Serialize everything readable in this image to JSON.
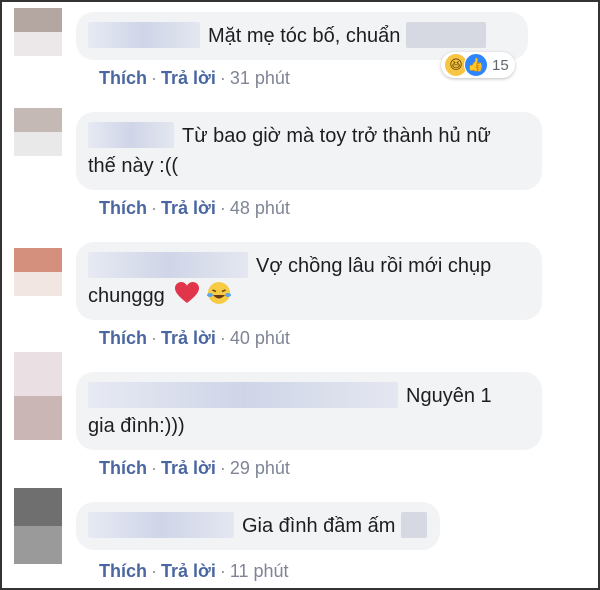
{
  "comments": [
    {
      "text": "Mặt mẹ tóc bố, chuẩn",
      "like": "Thích",
      "reply": "Trả lời",
      "time": "31 phút",
      "reactions": {
        "types": [
          "haha-icon",
          "like-icon"
        ],
        "count": "15"
      },
      "avatar_colors": [
        "#b4a7a1",
        "#ece8e9"
      ]
    },
    {
      "text_line1": "Từ bao giờ mà toy trở thành hủ nữ",
      "text_line2": "thế này :((",
      "like": "Thích",
      "reply": "Trả lời",
      "time": "48 phút",
      "avatar_colors": [
        "#c4b9b4",
        "#e9e9e9"
      ]
    },
    {
      "text_line1": "Vợ chồng lâu rồi mới chụp",
      "text_line2": "chunggg",
      "emojis": [
        "heart-icon",
        "tears-of-joy-icon"
      ],
      "like": "Thích",
      "reply": "Trả lời",
      "time": "40 phút",
      "avatar_colors": [
        "#d4907c",
        "#f1e6e2"
      ]
    },
    {
      "text_line1": "Nguyên 1",
      "text_line2": "gia đình:)))",
      "like": "Thích",
      "reply": "Trả lời",
      "time": "29 phút",
      "avatar_colors": [
        "#eadfe2",
        "#cbb6b6"
      ]
    },
    {
      "text": "Gia đình đầm ấm",
      "like": "Thích",
      "reply": "Trả lời",
      "time": "11 phút",
      "avatar_colors": [
        "#6f6f6f",
        "#9a9a9a"
      ]
    }
  ],
  "colors": {
    "bubble": "#f2f3f5",
    "link": "#4b67a1",
    "meta": "#7f8595",
    "text": "#1c1e21"
  }
}
